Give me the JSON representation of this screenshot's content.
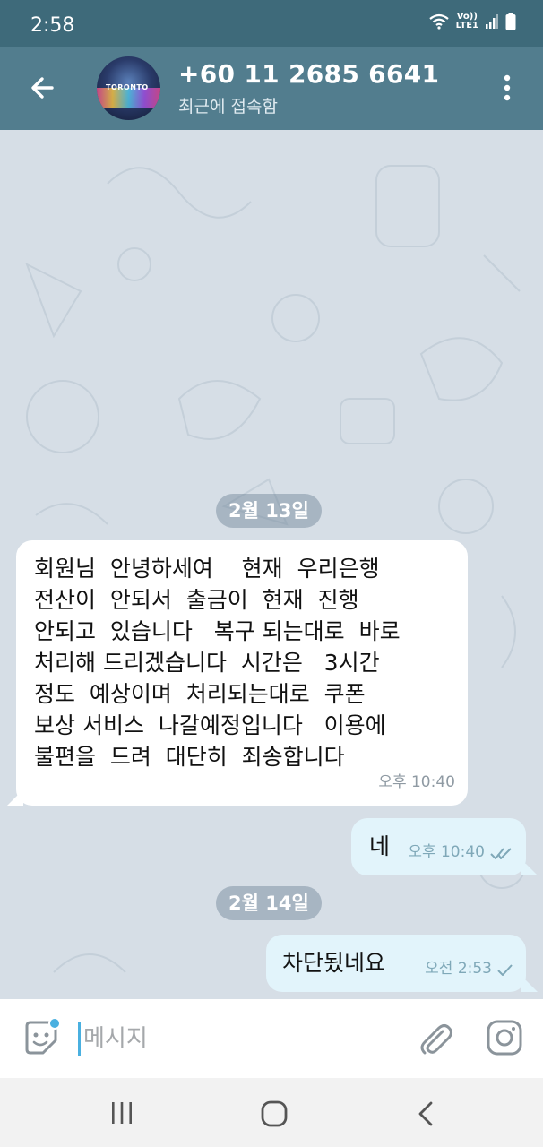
{
  "status_bar": {
    "time": "2:58",
    "network_label_top": "Vo))",
    "network_label_bottom": "LTE1"
  },
  "header": {
    "contact_name": "+60 11 2685 6641",
    "contact_status": "최근에 접속함",
    "avatar_sign": "TORONTO"
  },
  "chat": {
    "date_1": "2월 13일",
    "msg_1": {
      "lines": [
        "회원님  안녕하세여    현재  우리은행",
        "전산이  안되서  출금이  현재  진행",
        "안되고  있습니다   복구 되는대로  바로",
        "처리해 드리겠습니다  시간은   3시간",
        "정도  예상이며  처리되는대로  쿠폰",
        "보상 서비스  나갈예정입니다   이용에",
        "불편을  드려  대단히  죄송합니다"
      ],
      "time": "오후 10:40"
    },
    "msg_2": {
      "text": "네",
      "time": "오후 10:40"
    },
    "date_2": "2월 14일",
    "msg_3": {
      "text": "차단됬네요",
      "time": "오전 2:53"
    }
  },
  "input": {
    "placeholder": "메시지"
  },
  "colors": {
    "header": "#527d8e",
    "status_bar": "#3e6a7a",
    "accent": "#4ab0e0",
    "outgoing_bubble": "#e2f4fb"
  },
  "icons": [
    "back-arrow-icon",
    "more-vert-icon",
    "sticker-icon",
    "paperclip-icon",
    "camera-icon",
    "wifi-icon",
    "signal-icon",
    "battery-icon"
  ]
}
